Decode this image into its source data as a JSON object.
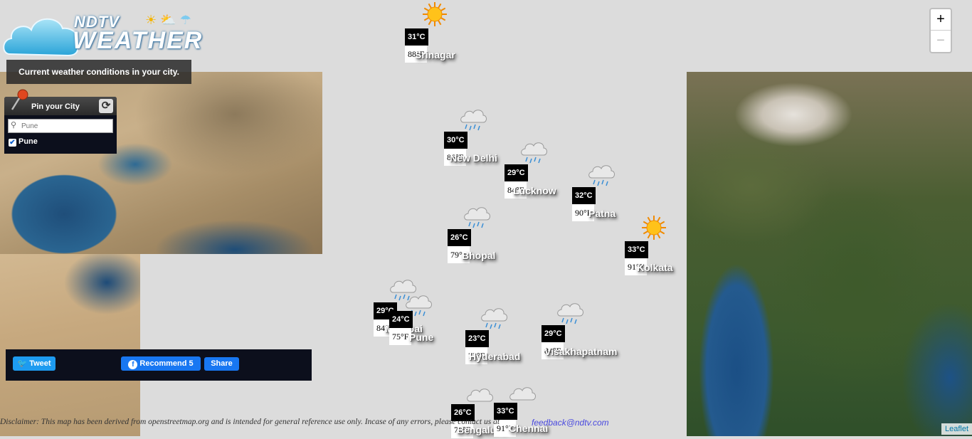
{
  "header": {
    "logo_ndtv": "NDTV",
    "logo_weather": "WEATHER",
    "subtitle": "Current weather conditions in your city."
  },
  "pin_panel": {
    "title": "Pin your City",
    "search_placeholder": "Pune",
    "checked_city": "Pune"
  },
  "zoom": {
    "in_label": "+",
    "out_label": "−"
  },
  "cities": [
    {
      "name": "Srinagar",
      "celsius": "31°C",
      "fahrenheit": "88°F",
      "icon": "sun-icon"
    },
    {
      "name": "New Delhi",
      "celsius": "30°C",
      "fahrenheit": "86°F",
      "icon": "rain-cloud-icon"
    },
    {
      "name": "Lucknow",
      "celsius": "29°C",
      "fahrenheit": "84°F",
      "icon": "rain-cloud-icon"
    },
    {
      "name": "Patna",
      "celsius": "32°C",
      "fahrenheit": "90°F",
      "icon": "rain-cloud-icon"
    },
    {
      "name": "Bhopal",
      "celsius": "26°C",
      "fahrenheit": "79°F",
      "icon": "rain-cloud-icon"
    },
    {
      "name": "Kolkata",
      "celsius": "33°C",
      "fahrenheit": "91°F",
      "icon": "sun-icon"
    },
    {
      "name": "Mumbai",
      "celsius": "29°C",
      "fahrenheit": "84°F",
      "icon": "rain-cloud-icon"
    },
    {
      "name": "Pune",
      "celsius": "24°C",
      "fahrenheit": "75°F",
      "icon": "rain-cloud-icon"
    },
    {
      "name": "Hyderabad",
      "celsius": "23°C",
      "fahrenheit": "73°F",
      "icon": "rain-cloud-icon"
    },
    {
      "name": "Visakhapatnam",
      "celsius": "29°C",
      "fahrenheit": "84°F",
      "icon": "rain-cloud-icon"
    },
    {
      "name": "Bengaluru",
      "celsius": "26°C",
      "fahrenheit": "79°F",
      "icon": "cloud-icon"
    },
    {
      "name": "Chennai",
      "celsius": "33°C",
      "fahrenheit": "91°F",
      "icon": "cloud-icon"
    }
  ],
  "share": {
    "tweet_label": "Tweet",
    "recommend_label": "Recommend 5",
    "share_label": "Share"
  },
  "footer": {
    "disclaimer": "Disclaimer: This map has been derived from openstreetmap.org and is intended for general reference use only. Incase of any errors, please contact us at",
    "feedback_email": "feedback@ndtv.com",
    "attribution": "Leaflet"
  }
}
